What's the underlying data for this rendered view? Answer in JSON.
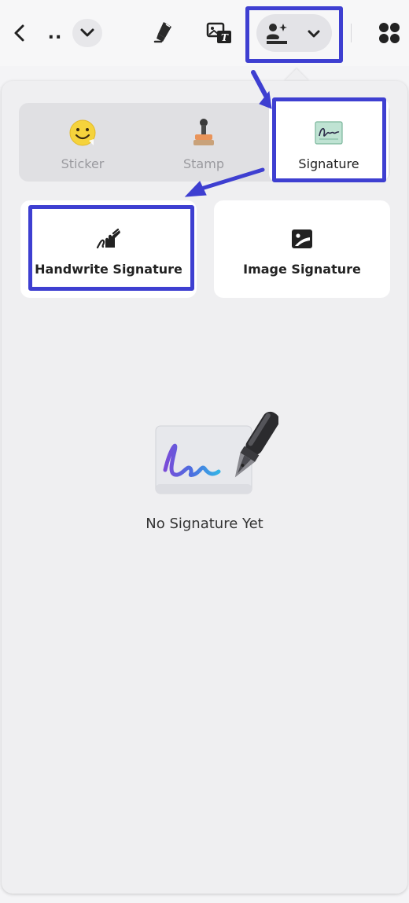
{
  "toolbar": {
    "back_icon": "chevron-left-icon",
    "more_text": "..",
    "dropdown_icon": "chevron-down-icon",
    "pen_icon": "highlighter-icon",
    "image_text_icon": "image-text-icon",
    "sign_tool_icon": "signature-tool-icon",
    "sign_tool_dropdown_icon": "chevron-down-icon",
    "apps_icon": "apps-grid-icon"
  },
  "tabs": [
    {
      "label": "Sticker",
      "icon": "smiley-sticker-icon",
      "active": false
    },
    {
      "label": "Stamp",
      "icon": "stamp-icon",
      "active": false
    },
    {
      "label": "Signature",
      "icon": "signature-icon",
      "active": true
    }
  ],
  "options": [
    {
      "label": "Handwrite Signature",
      "icon": "handwrite-icon"
    },
    {
      "label": "Image Signature",
      "icon": "image-icon"
    }
  ],
  "empty_state": {
    "text": "No Signature Yet",
    "illustration": "signature-pen-illustration"
  },
  "colors": {
    "highlight": "#3e3fd1",
    "panel_bg": "#efeff1",
    "card_bg": "#ffffff"
  }
}
